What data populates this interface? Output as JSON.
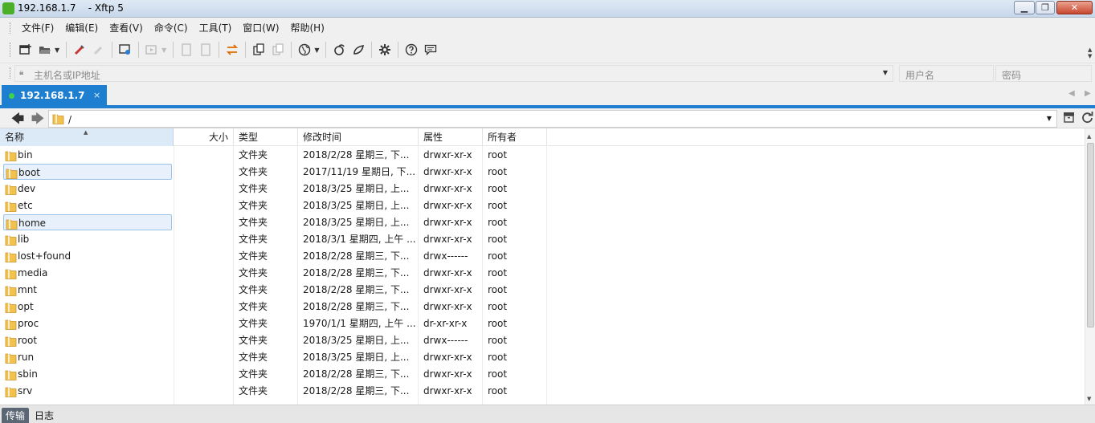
{
  "window": {
    "title": "192.168.1.7    - Xftp 5",
    "minimize": "▁",
    "maximize": "❐",
    "close": "✕"
  },
  "menu": [
    "文件(F)",
    "编辑(E)",
    "查看(V)",
    "命令(C)",
    "工具(T)",
    "窗口(W)",
    "帮助(H)"
  ],
  "toolbar": {
    "icons": [
      "new-session-icon",
      "open-folder-icon",
      "edit-icon",
      "disconnect-icon",
      "properties-icon",
      "transfer-icon",
      "upload-icon",
      "download-icon",
      "sync-icon",
      "copy-icon",
      "paste-icon",
      "globe-icon",
      "xshell-icon",
      "xftp-icon",
      "settings-icon",
      "help-icon",
      "feedback-icon"
    ]
  },
  "address": {
    "host_placeholder": "主机名或IP地址",
    "user_placeholder": "用户名",
    "password_placeholder": "密码"
  },
  "tabs": [
    {
      "label": "192.168.1.7",
      "active": true,
      "status_color": "#3fd34c",
      "close": "×"
    }
  ],
  "path": {
    "value": "/"
  },
  "columns": {
    "name": "名称",
    "size": "大小",
    "type": "类型",
    "modified": "修改时间",
    "attributes": "属性",
    "owner": "所有者"
  },
  "files": [
    {
      "name": "bin",
      "type": "文件夹",
      "modified": "2018/2/28 星期三, 下...",
      "attr": "drwxr-xr-x",
      "owner": "root"
    },
    {
      "name": "boot",
      "type": "文件夹",
      "modified": "2017/11/19 星期日, 下...",
      "attr": "drwxr-xr-x",
      "owner": "root",
      "hover": true
    },
    {
      "name": "dev",
      "type": "文件夹",
      "modified": "2018/3/25 星期日, 上...",
      "attr": "drwxr-xr-x",
      "owner": "root"
    },
    {
      "name": "etc",
      "type": "文件夹",
      "modified": "2018/3/25 星期日, 上...",
      "attr": "drwxr-xr-x",
      "owner": "root"
    },
    {
      "name": "home",
      "type": "文件夹",
      "modified": "2018/3/25 星期日, 上...",
      "attr": "drwxr-xr-x",
      "owner": "root",
      "selected": true
    },
    {
      "name": "lib",
      "type": "文件夹",
      "modified": "2018/3/1 星期四, 上午 ...",
      "attr": "drwxr-xr-x",
      "owner": "root"
    },
    {
      "name": "lost+found",
      "type": "文件夹",
      "modified": "2018/2/28 星期三, 下...",
      "attr": "drwx------",
      "owner": "root"
    },
    {
      "name": "media",
      "type": "文件夹",
      "modified": "2018/2/28 星期三, 下...",
      "attr": "drwxr-xr-x",
      "owner": "root"
    },
    {
      "name": "mnt",
      "type": "文件夹",
      "modified": "2018/2/28 星期三, 下...",
      "attr": "drwxr-xr-x",
      "owner": "root"
    },
    {
      "name": "opt",
      "type": "文件夹",
      "modified": "2018/2/28 星期三, 下...",
      "attr": "drwxr-xr-x",
      "owner": "root"
    },
    {
      "name": "proc",
      "type": "文件夹",
      "modified": "1970/1/1 星期四, 上午 ...",
      "attr": "dr-xr-xr-x",
      "owner": "root"
    },
    {
      "name": "root",
      "type": "文件夹",
      "modified": "2018/3/25 星期日, 上...",
      "attr": "drwx------",
      "owner": "root"
    },
    {
      "name": "run",
      "type": "文件夹",
      "modified": "2018/3/25 星期日, 上...",
      "attr": "drwxr-xr-x",
      "owner": "root"
    },
    {
      "name": "sbin",
      "type": "文件夹",
      "modified": "2018/2/28 星期三, 下...",
      "attr": "drwxr-xr-x",
      "owner": "root"
    },
    {
      "name": "srv",
      "type": "文件夹",
      "modified": "2018/2/28 星期三, 下...",
      "attr": "drwxr-xr-x",
      "owner": "root"
    }
  ],
  "bottom_tabs": [
    "传输",
    "日志"
  ],
  "colors": {
    "accent": "#1e7fd1",
    "folder": "#f2c14e",
    "selection": "#e8f1fb"
  }
}
